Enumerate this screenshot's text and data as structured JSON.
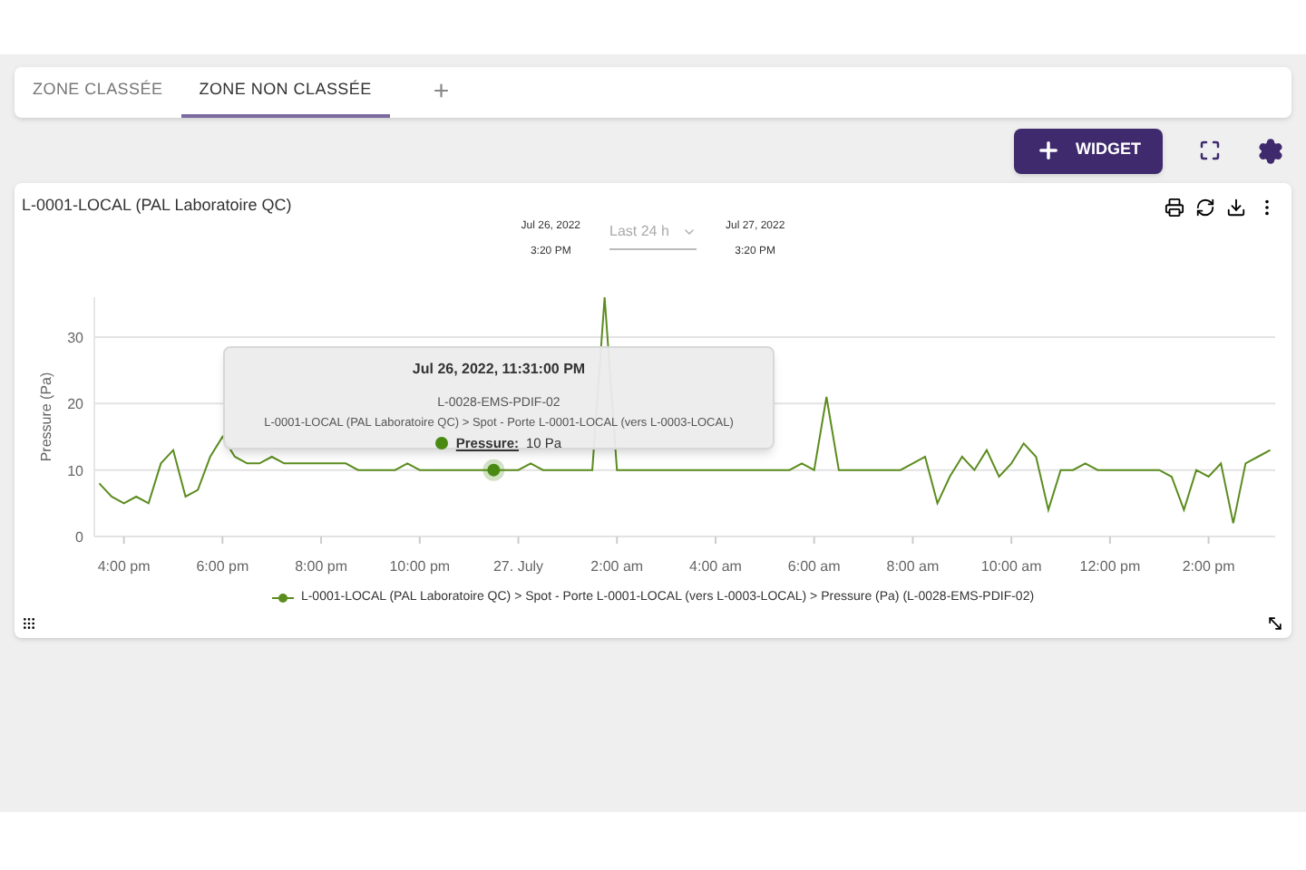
{
  "tabs": [
    {
      "label": "ZONE CLASSÉE",
      "selected": false
    },
    {
      "label": "ZONE NON CLASSÉE",
      "selected": true
    }
  ],
  "add_tab": "+",
  "toolbar": {
    "widget_button": "WIDGET"
  },
  "widget": {
    "title": "L-0001-LOCAL (PAL Laboratoire QC)",
    "range": {
      "start_date": "Jul 26, 2022",
      "start_time": "3:20 PM",
      "period": "Last 24 h",
      "end_date": "Jul 27, 2022",
      "end_time": "3:20 PM"
    },
    "chart_data": {
      "type": "line",
      "ylabel": "Pressure (Pa)",
      "grid": true,
      "ylim": [
        0,
        36
      ],
      "xlim": [
        "2022-07-26T15:24",
        "2022-07-27T15:21"
      ],
      "yticks": [
        0,
        10,
        20,
        30
      ],
      "xticks": [
        {
          "value": "2022-07-26T16:00",
          "label": "4:00 pm"
        },
        {
          "value": "2022-07-26T18:00",
          "label": "6:00 pm"
        },
        {
          "value": "2022-07-26T20:00",
          "label": "8:00 pm"
        },
        {
          "value": "2022-07-26T22:00",
          "label": "10:00 pm"
        },
        {
          "value": "2022-07-27T00:00",
          "label": "27. July"
        },
        {
          "value": "2022-07-27T02:00",
          "label": "2:00 am"
        },
        {
          "value": "2022-07-27T04:00",
          "label": "4:00 am"
        },
        {
          "value": "2022-07-27T06:00",
          "label": "6:00 am"
        },
        {
          "value": "2022-07-27T08:00",
          "label": "8:00 am"
        },
        {
          "value": "2022-07-27T10:00",
          "label": "10:00 am"
        },
        {
          "value": "2022-07-27T12:00",
          "label": "12:00 pm"
        },
        {
          "value": "2022-07-27T14:00",
          "label": "2:00 pm"
        }
      ],
      "x": [
        "2022-07-26T15:30",
        "2022-07-26T15:45",
        "2022-07-26T16:00",
        "2022-07-26T16:15",
        "2022-07-26T16:30",
        "2022-07-26T16:45",
        "2022-07-26T17:00",
        "2022-07-26T17:15",
        "2022-07-26T17:30",
        "2022-07-26T17:45",
        "2022-07-26T18:00",
        "2022-07-26T18:15",
        "2022-07-26T18:30",
        "2022-07-26T18:45",
        "2022-07-26T19:00",
        "2022-07-26T19:15",
        "2022-07-26T19:30",
        "2022-07-26T19:45",
        "2022-07-26T20:00",
        "2022-07-26T20:15",
        "2022-07-26T20:30",
        "2022-07-26T20:45",
        "2022-07-26T21:00",
        "2022-07-26T21:15",
        "2022-07-26T21:30",
        "2022-07-26T21:45",
        "2022-07-26T22:00",
        "2022-07-26T22:15",
        "2022-07-26T22:30",
        "2022-07-26T22:45",
        "2022-07-26T23:00",
        "2022-07-26T23:15",
        "2022-07-26T23:30",
        "2022-07-26T23:45",
        "2022-07-27T00:00",
        "2022-07-27T00:15",
        "2022-07-27T00:30",
        "2022-07-27T00:45",
        "2022-07-27T01:00",
        "2022-07-27T01:15",
        "2022-07-27T01:30",
        "2022-07-27T01:45",
        "2022-07-27T02:00",
        "2022-07-27T02:15",
        "2022-07-27T02:30",
        "2022-07-27T02:45",
        "2022-07-27T03:00",
        "2022-07-27T03:15",
        "2022-07-27T03:30",
        "2022-07-27T03:45",
        "2022-07-27T04:00",
        "2022-07-27T04:15",
        "2022-07-27T04:30",
        "2022-07-27T04:45",
        "2022-07-27T05:00",
        "2022-07-27T05:15",
        "2022-07-27T05:30",
        "2022-07-27T05:45",
        "2022-07-27T06:00",
        "2022-07-27T06:15",
        "2022-07-27T06:30",
        "2022-07-27T06:45",
        "2022-07-27T07:00",
        "2022-07-27T07:15",
        "2022-07-27T07:30",
        "2022-07-27T07:45",
        "2022-07-27T08:00",
        "2022-07-27T08:15",
        "2022-07-27T08:30",
        "2022-07-27T08:45",
        "2022-07-27T09:00",
        "2022-07-27T09:15",
        "2022-07-27T09:30",
        "2022-07-27T09:45",
        "2022-07-27T10:00",
        "2022-07-27T10:15",
        "2022-07-27T10:30",
        "2022-07-27T10:45",
        "2022-07-27T11:00",
        "2022-07-27T11:15",
        "2022-07-27T11:30",
        "2022-07-27T11:45",
        "2022-07-27T12:00",
        "2022-07-27T12:15",
        "2022-07-27T12:30",
        "2022-07-27T12:45",
        "2022-07-27T13:00",
        "2022-07-27T13:15",
        "2022-07-27T13:30",
        "2022-07-27T13:45",
        "2022-07-27T14:00",
        "2022-07-27T14:15",
        "2022-07-27T14:30",
        "2022-07-27T14:45",
        "2022-07-27T15:00",
        "2022-07-27T15:15"
      ],
      "series": [
        {
          "name": "L-0001-LOCAL (PAL Laboratoire QC) > Spot - Porte L-0001-LOCAL (vers L-0003-LOCAL) > Pressure (Pa) (L-0028-EMS-PDIF-02)",
          "color": "#5b8c1e",
          "values": [
            8,
            6,
            5,
            6,
            5,
            11,
            13,
            6,
            7,
            12,
            15,
            12,
            11,
            11,
            12,
            11,
            11,
            11,
            11,
            11,
            11,
            10,
            10,
            10,
            10,
            11,
            10,
            10,
            10,
            10,
            10,
            10,
            10,
            10,
            10,
            11,
            10,
            10,
            10,
            10,
            10,
            36,
            10,
            10,
            10,
            10,
            10,
            10,
            10,
            10,
            10,
            10,
            10,
            10,
            10,
            10,
            10,
            11,
            10,
            21,
            10,
            10,
            10,
            10,
            10,
            10,
            11,
            12,
            5,
            9,
            12,
            10,
            13,
            9,
            11,
            14,
            12,
            4,
            10,
            10,
            11,
            10,
            10,
            10,
            10,
            10,
            10,
            9,
            4,
            10,
            9,
            11,
            2,
            11,
            12,
            13
          ]
        }
      ]
    },
    "tooltip": {
      "title": "Jul 26, 2022, 11:31:00 PM",
      "sensor": "L-0028-EMS-PDIF-02",
      "path": "L-0001-LOCAL (PAL Laboratoire QC) > Spot - Porte L-0001-LOCAL (vers L-0003-LOCAL)",
      "label": "Pressure:",
      "value": "10 Pa",
      "color": "#4a8a12"
    }
  }
}
